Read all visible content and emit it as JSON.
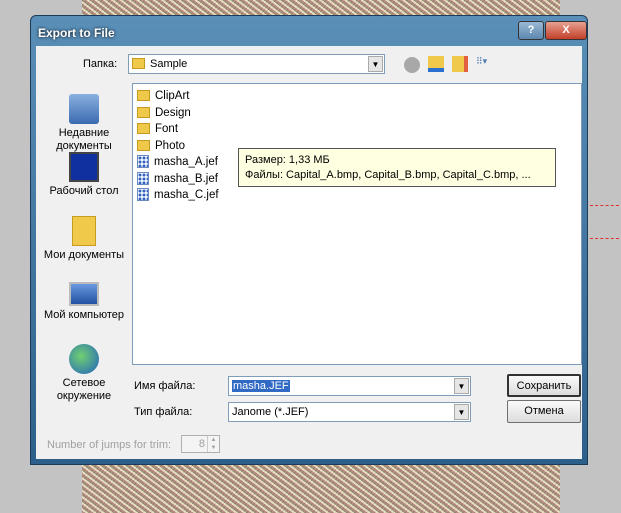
{
  "dialog": {
    "title": "Export to File",
    "help": "?",
    "close": "X"
  },
  "folder": {
    "label": "Папка:",
    "value": "Sample"
  },
  "places": [
    {
      "label": "Недавние документы"
    },
    {
      "label": "Рабочий стол"
    },
    {
      "label": "Мои документы"
    },
    {
      "label": "Мой компьютер"
    },
    {
      "label": "Сетевое окружение"
    }
  ],
  "files": [
    {
      "name": "ClipArt",
      "type": "folder"
    },
    {
      "name": "Design",
      "type": "folder"
    },
    {
      "name": "Font",
      "type": "folder"
    },
    {
      "name": "Photo",
      "type": "folder"
    },
    {
      "name": "masha_A.jef",
      "type": "file"
    },
    {
      "name": "masha_B.jef",
      "type": "file"
    },
    {
      "name": "masha_C.jef",
      "type": "file"
    }
  ],
  "tooltip": {
    "size": "Размер: 1,33 МБ",
    "files": "Файлы: Capital_A.bmp, Capital_B.bmp, Capital_C.bmp, ..."
  },
  "filename": {
    "label": "Имя файла:",
    "value": "masha.JEF"
  },
  "filetype": {
    "label": "Тип файла:",
    "value": "Janome (*.JEF)"
  },
  "buttons": {
    "save": "Сохранить",
    "cancel": "Отмена"
  },
  "jumps": {
    "label": "Number of jumps for trim:",
    "value": "8"
  }
}
